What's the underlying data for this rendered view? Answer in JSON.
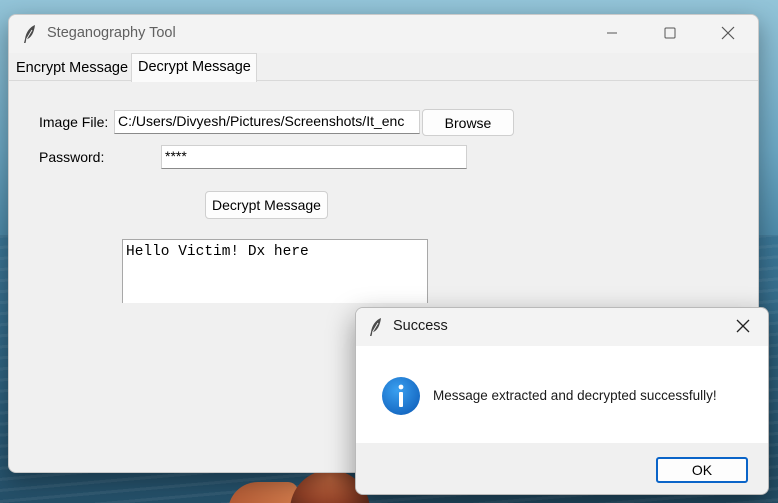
{
  "window": {
    "title": "Steganography Tool",
    "icon": "feather-icon",
    "controls": [
      "minimize-icon",
      "maximize-icon",
      "close-icon"
    ]
  },
  "tabs": [
    {
      "label": "Encrypt Message",
      "selected": false
    },
    {
      "label": "Decrypt Message",
      "selected": true
    }
  ],
  "form": {
    "image_label": "Image File:",
    "image_value": "C:/Users/Divyesh/Pictures/Screenshots/It_enc",
    "browse_label": "Browse",
    "password_label": "Password:",
    "password_value": "****",
    "decrypt_label": "Decrypt Message",
    "output_text": "Hello Victim! Dx here"
  },
  "dialog": {
    "title": "Success",
    "icon": "info-icon",
    "message": "Message extracted and decrypted successfully!",
    "ok_label": "OK"
  },
  "colors": {
    "window_bg": "#f0f0f0",
    "accent": "#0a64c8",
    "info_icon": "#1b7fd6"
  }
}
